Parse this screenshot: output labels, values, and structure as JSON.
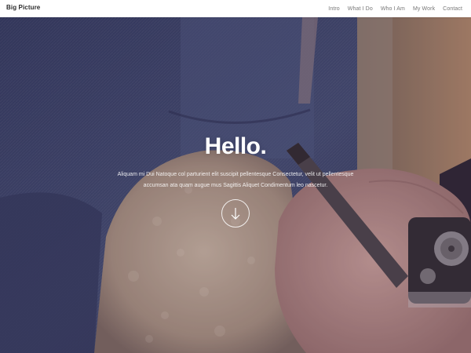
{
  "header": {
    "logo": "Big Picture",
    "nav": [
      {
        "label": "Intro"
      },
      {
        "label": "What I Do"
      },
      {
        "label": "Who I Am"
      },
      {
        "label": "My Work"
      },
      {
        "label": "Contact"
      }
    ]
  },
  "hero": {
    "title": "Hello.",
    "text_line1": "Aliquam mi Dui Natoque col parturient elit suscipit pellentesque Consectetur, velit ut pellentesque",
    "text_line2": "accumsan ata quam augue mus Sagittis Aliquet Condimentum leo nascetur.",
    "scroll_icon": "arrow-down-icon"
  },
  "colors": {
    "header_bg": "#ffffff",
    "logo": "#2b2b2b",
    "nav_text": "#777777",
    "hero_text": "#ffffff"
  }
}
